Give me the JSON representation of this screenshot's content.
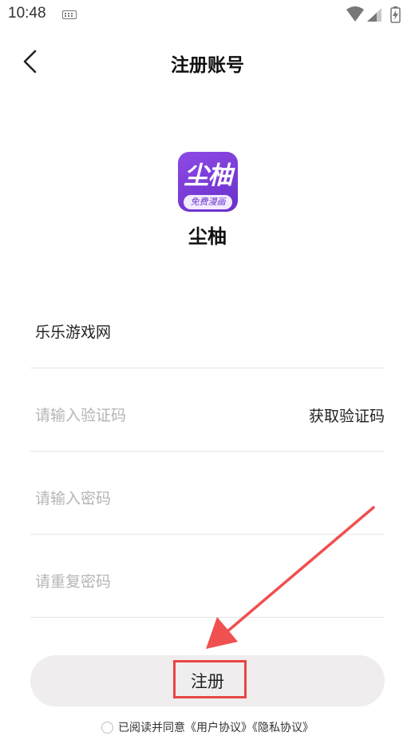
{
  "status_bar": {
    "time": "10:48",
    "icons": [
      "keyboard-icon",
      "wifi-icon",
      "signal-icon",
      "battery-icon"
    ]
  },
  "nav": {
    "title": "注册账号",
    "back_icon": "chevron-left-icon"
  },
  "app": {
    "logo_text": "尘柚",
    "logo_tag": "免费漫画",
    "name": "尘柚",
    "brand_color": "#7a3ddb"
  },
  "form": {
    "username_value": "乐乐游戏网",
    "code_placeholder": "请输入验证码",
    "get_code_label": "获取验证码",
    "password_placeholder": "请输入密码",
    "confirm_password_placeholder": "请重复密码"
  },
  "register_button": {
    "label": "注册",
    "highlight_color": "#e84545"
  },
  "agreement": {
    "text": "已阅读并同意《用户协议》《隐私协议》",
    "checked": false
  }
}
